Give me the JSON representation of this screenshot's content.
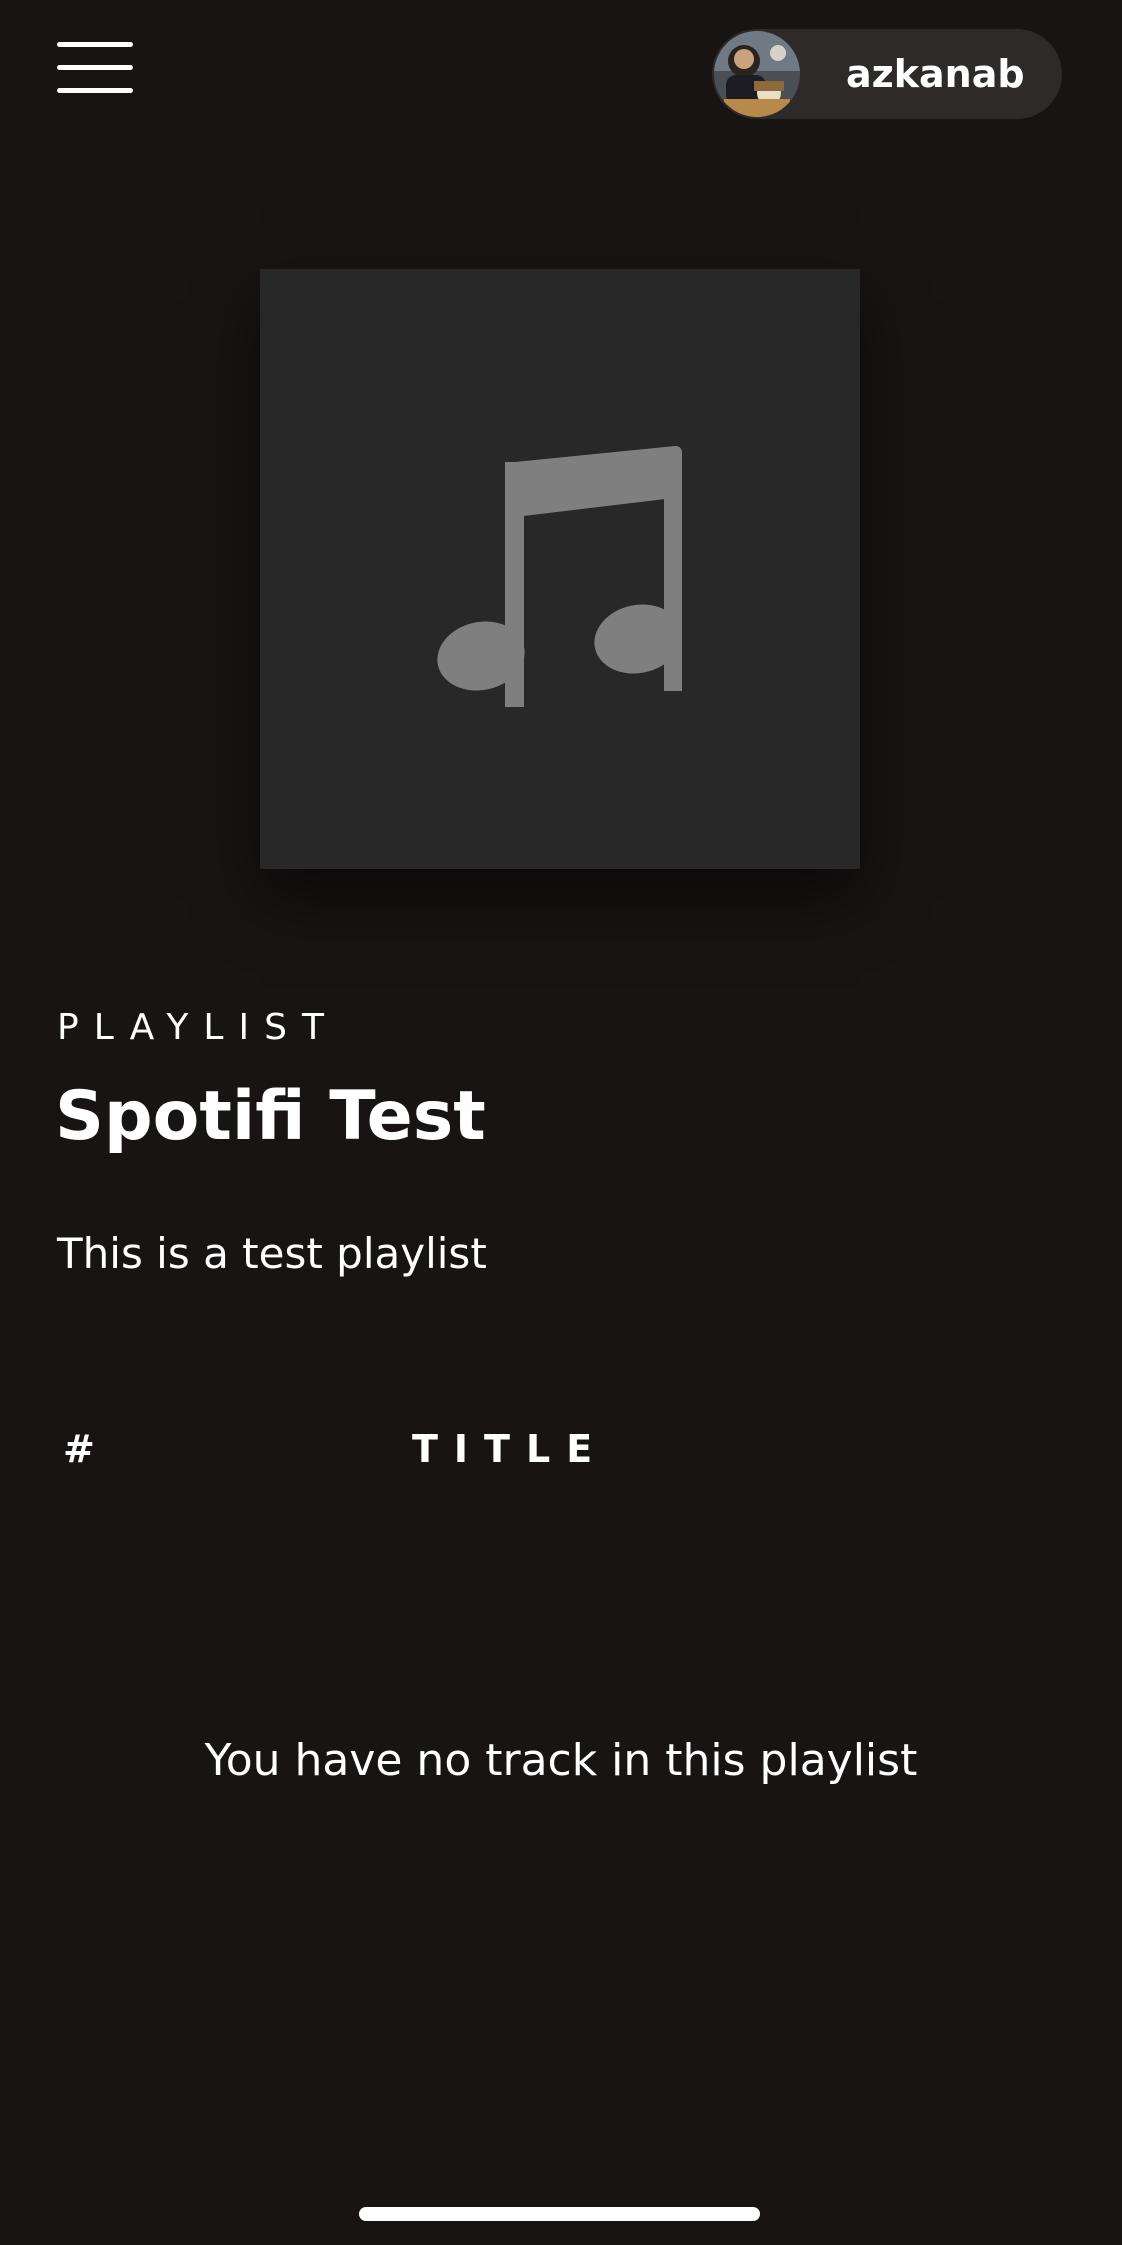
{
  "header": {
    "menu_icon": "hamburger-menu-icon",
    "user": {
      "name": "azkanab",
      "avatar": "user-avatar-photo"
    }
  },
  "playlist": {
    "cover_icon": "music-note-icon",
    "kind": "PLAYLIST",
    "title": "Spotifi Test",
    "description": "This is a test playlist"
  },
  "track_table": {
    "columns": [
      "#",
      "TITLE"
    ],
    "empty_message": "You have no track in this playlist"
  },
  "colors": {
    "background": "#181414",
    "pill": "#2e2a2a",
    "cover": "#282828",
    "cover_icon": "#7f7f7f",
    "text": "#ffffff"
  }
}
